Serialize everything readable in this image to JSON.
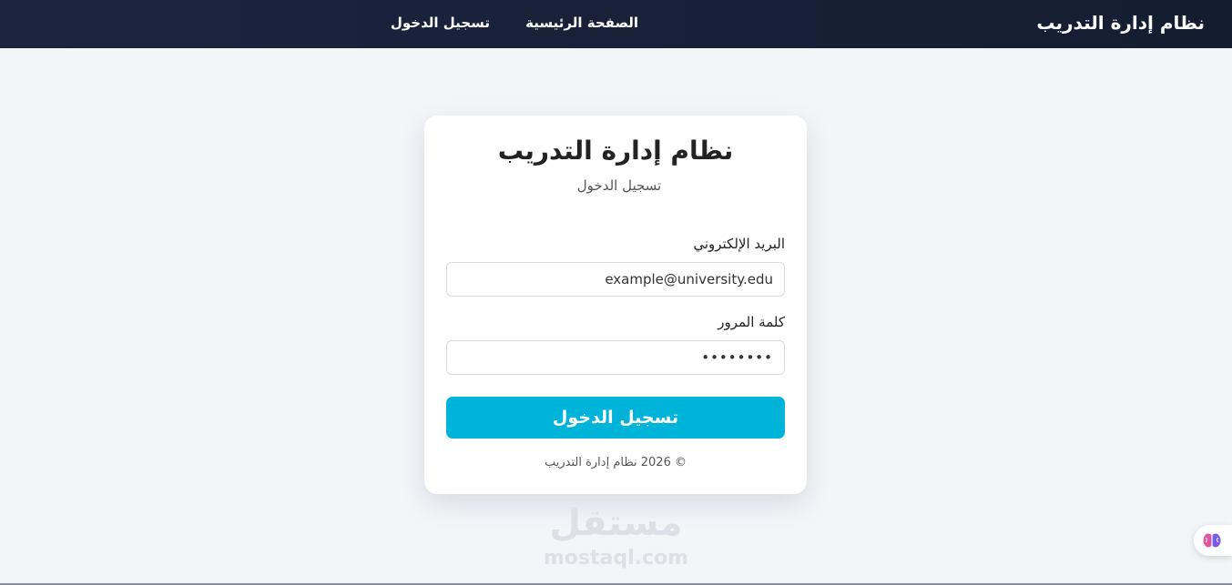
{
  "nav": {
    "brand": "نظام إدارة التدريب",
    "links": [
      {
        "label": "الصفحة الرئيسية"
      },
      {
        "label": "تسجيل الدخول"
      }
    ]
  },
  "login": {
    "title": "نظام إدارة التدريب",
    "subtitle": "تسجيل الدخول",
    "email": {
      "label": "البريد الإلكتروني",
      "value": "example@university.edu"
    },
    "password": {
      "label": "كلمة المرور",
      "value": "••••••••"
    },
    "submit_label": "تسجيل الدخول",
    "footer": "© 2026 نظام إدارة التدريب"
  },
  "watermark": {
    "arabic": "مستقل",
    "latin": "mostaql.com"
  },
  "icons": {
    "assistant": "brain-icon"
  },
  "colors": {
    "navbar": "#1b2540",
    "accent": "#00b3d8",
    "background": "#f3f5f9"
  }
}
